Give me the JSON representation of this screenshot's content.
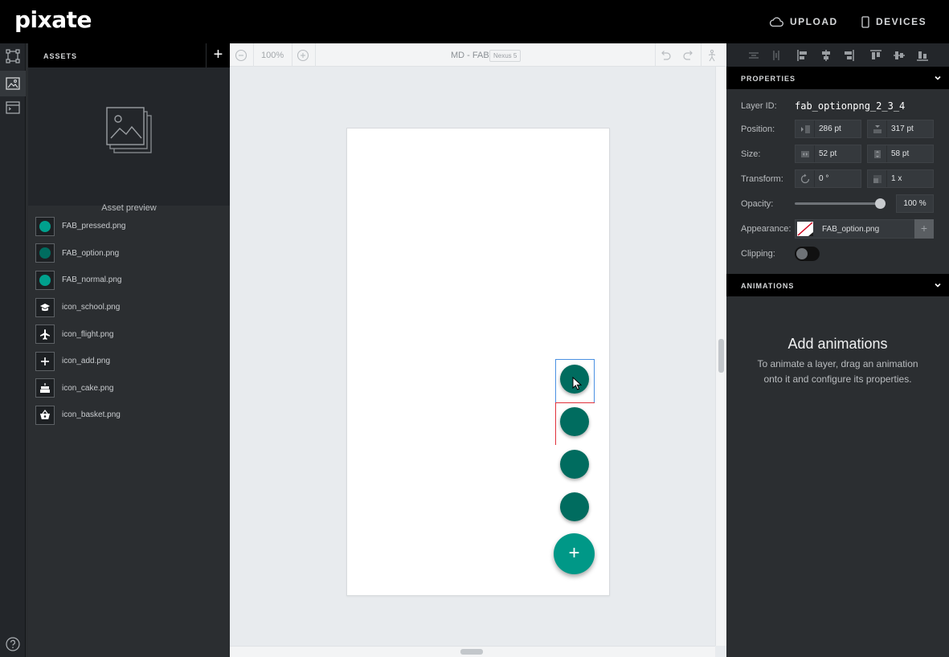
{
  "app": {
    "logo": "pixate",
    "upload_label": "UPLOAD",
    "devices_label": "DEVICES"
  },
  "assets": {
    "title": "ASSETS",
    "add_label": "+",
    "preview_label": "Asset preview",
    "items": [
      {
        "name": "FAB_pressed.png",
        "icon": "teal-dot",
        "color": "#00a08d"
      },
      {
        "name": "FAB_option.png",
        "icon": "teal-dot",
        "color": "#006c5f"
      },
      {
        "name": "FAB_normal.png",
        "icon": "teal-dot",
        "color": "#00a08d"
      },
      {
        "name": "icon_school.png",
        "icon": "school-icon"
      },
      {
        "name": "icon_flight.png",
        "icon": "flight-icon"
      },
      {
        "name": "icon_add.png",
        "icon": "add-icon"
      },
      {
        "name": "icon_cake.png",
        "icon": "cake-icon"
      },
      {
        "name": "icon_basket.png",
        "icon": "basket-icon"
      }
    ]
  },
  "canvas": {
    "zoom": "100%",
    "doc_title": "MD - FAB",
    "device": "Nexus 5",
    "fab_main_label": "+",
    "colors": {
      "fab_main": "#009887",
      "fab_option": "#006c5f",
      "selection": "#4a90e2",
      "guide": "#e0303a"
    }
  },
  "properties": {
    "title": "PROPERTIES",
    "layer_id_label": "Layer ID:",
    "layer_id": "fab_optionpng_2_3_4",
    "position_label": "Position:",
    "pos_x": "286 pt",
    "pos_y": "317 pt",
    "size_label": "Size:",
    "width": "52 pt",
    "height": "58 pt",
    "transform_label": "Transform:",
    "rotation": "0 °",
    "scale": "1 x",
    "opacity_label": "Opacity:",
    "opacity": "100 %",
    "opacity_value": 1.0,
    "appearance_label": "Appearance:",
    "appearance_value": "FAB_option.png",
    "appearance_add": "+",
    "clipping_label": "Clipping:",
    "clipping_on": false
  },
  "animations": {
    "title": "ANIMATIONS",
    "empty_title": "Add animations",
    "empty_desc": "To animate a layer, drag an animation onto it and configure its properties."
  }
}
